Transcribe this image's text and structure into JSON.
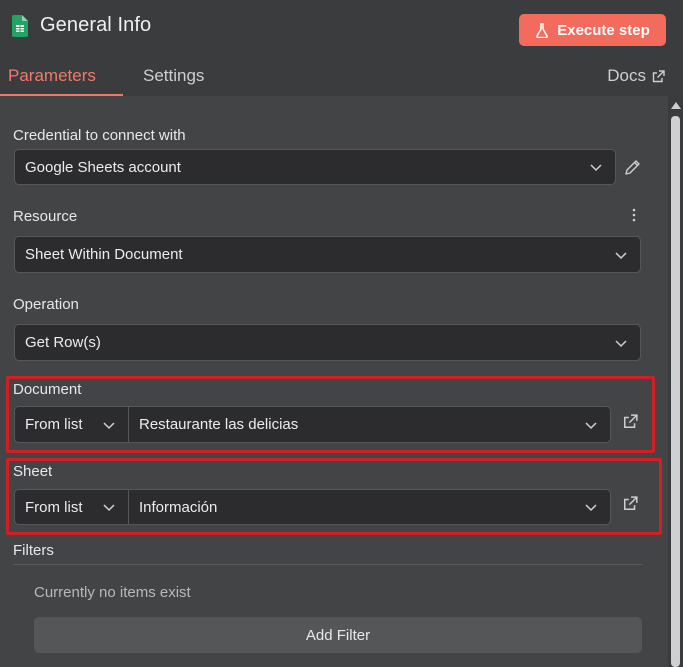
{
  "header": {
    "title": "General Info",
    "execute_label": "Execute step",
    "icon": "google-sheets-icon"
  },
  "tabs": {
    "parameters": "Parameters",
    "settings": "Settings",
    "docs": "Docs"
  },
  "form": {
    "credential": {
      "label": "Credential to connect with",
      "value": "Google Sheets account"
    },
    "resource": {
      "label": "Resource",
      "value": "Sheet Within Document"
    },
    "operation": {
      "label": "Operation",
      "value": "Get Row(s)"
    },
    "document": {
      "label": "Document",
      "mode": "From list",
      "value": "Restaurante las delicias"
    },
    "sheet": {
      "label": "Sheet",
      "mode": "From list",
      "value": "Información"
    },
    "filters": {
      "label": "Filters",
      "empty_text": "Currently no items exist",
      "add_label": "Add Filter"
    }
  },
  "colors": {
    "accent": "#f26b5c",
    "highlight": "#d21f26",
    "background": "#434446"
  }
}
